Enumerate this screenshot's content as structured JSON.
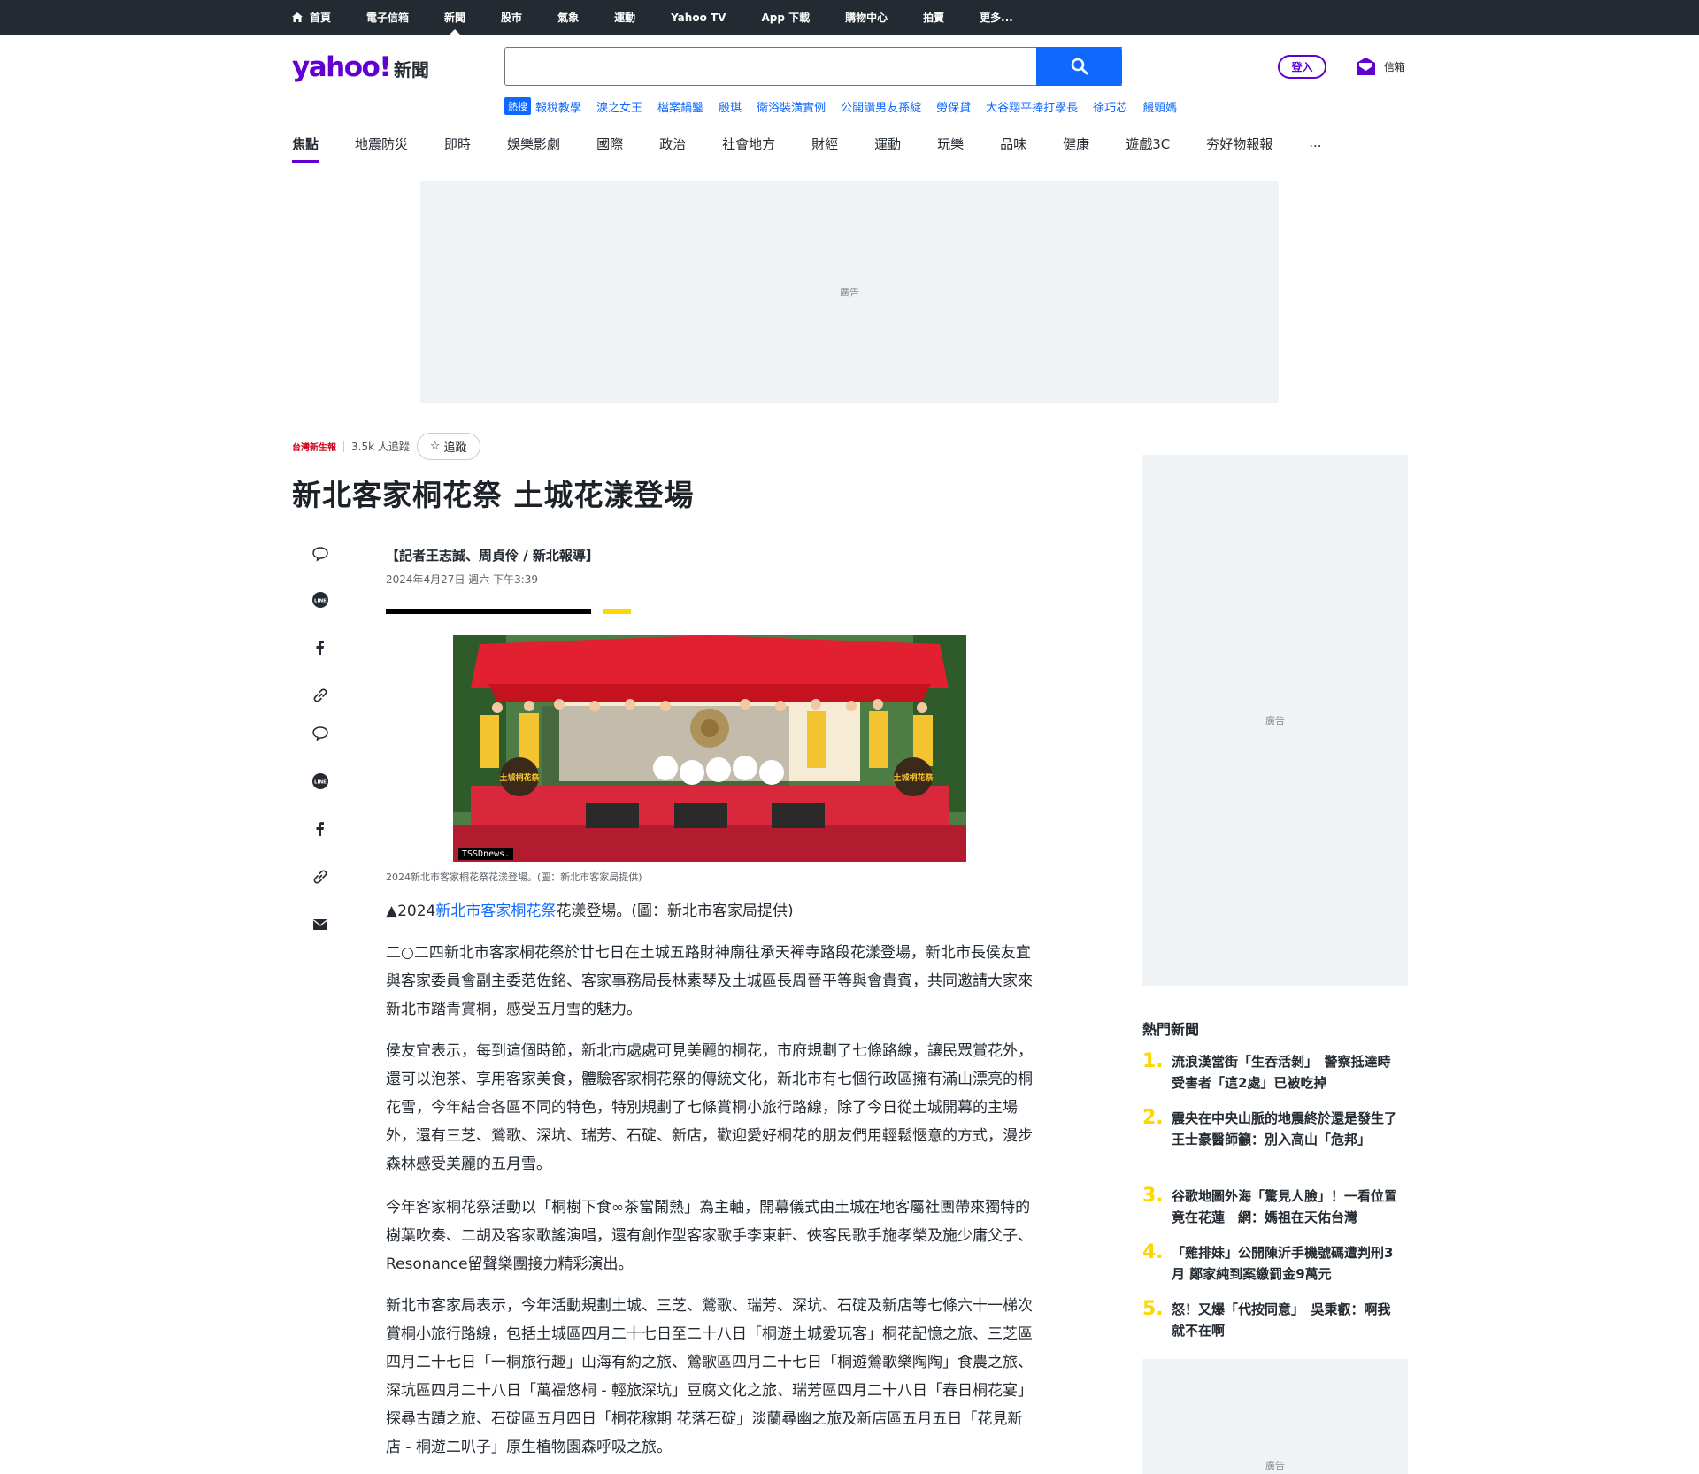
{
  "topnav": {
    "items": [
      "首頁",
      "電子信箱",
      "新聞",
      "股市",
      "氣象",
      "運動",
      "Yahoo TV",
      "App 下載",
      "購物中心",
      "拍賣",
      "更多..."
    ]
  },
  "header": {
    "logo": "yahoo!",
    "logo_sub": "新聞",
    "search_placeholder": "",
    "login": "登入",
    "mail": "信箱"
  },
  "trending": {
    "badge": "熱搜",
    "links": [
      "報稅教學",
      "淚之女王",
      "檔案鍋鑿",
      "殷琪",
      "衛浴裝潢實例",
      "公開讚男友孫綻",
      "勞保貸",
      "大谷翔平捧打學長",
      "徐巧芯",
      "饅頭媽"
    ]
  },
  "categories": [
    "焦點",
    "地震防災",
    "即時",
    "娛樂影劇",
    "國際",
    "政治",
    "社會地方",
    "財經",
    "運動",
    "玩樂",
    "品味",
    "健康",
    "遊戲3C",
    "夯好物報報",
    "..."
  ],
  "ads": {
    "label": "廣告"
  },
  "article": {
    "source_logo": "台灣新生報",
    "followers": "3.5k 人追蹤",
    "follow": "追蹤",
    "title": "新北客家桐花祭 土城花漾登場",
    "byline": "【記者王志誠、周貞伶 / 新北報導】",
    "date": "2024年4月27日 週六 下午3:39",
    "photo_tag": "TSSDnews.",
    "photo_sign_1": "土城桐花祭",
    "photo_sign_2": "土城桐花祭",
    "caption": "2024新北市客家桐花祭花漾登場。(圖：新北市客家局提供)",
    "lead_prefix": "▲2024",
    "lead_link": "新北市客家桐花祭",
    "lead_suffix": "花漾登場。(圖：新北市客家局提供)",
    "paragraphs": [
      "二○二四新北市客家桐花祭於廿七日在土城五路財神廟往承天禪寺路段花漾登場，新北市長侯友宜與客家委員會副主委范佐銘、客家事務局長林素琴及土城區長周晉平等與會貴賓，共同邀請大家來新北市踏青賞桐，感受五月雪的魅力。",
      "侯友宜表示，每到這個時節，新北市處處可見美麗的桐花，市府規劃了七條路線，讓民眾賞花外，還可以泡茶、享用客家美食，體驗客家桐花祭的傳統文化，新北市有七個行政區擁有滿山漂亮的桐花雪，今年結合各區不同的特色，特別規劃了七條賞桐小旅行路線，除了今日從土城開幕的主場外，還有三芝、鶯歌、深坑、瑞芳、石碇、新店，歡迎愛好桐花的朋友們用輕鬆愜意的方式，漫步森林感受美麗的五月雪。",
      "今年客家桐花祭活動以「桐樹下食∞茶當鬧熱」為主軸，開幕儀式由土城在地客屬社團帶來獨特的樹葉吹奏、二胡及客家歌謠演唱，還有創作型客家歌手李東軒、俠客民歌手施孝榮及施少庸父子、Resonance留聲樂團接力精彩演出。",
      "新北市客家局表示，今年活動規劃土城、三芝、鶯歌、瑞芳、深坑、石碇及新店等七條六十一梯次賞桐小旅行路線，包括土城區四月二十七日至二十八日「桐遊土城愛玩客」桐花記憶之旅、三芝區四月二十七日「一桐旅行趣」山海有約之旅、鶯歌區四月二十七日「桐遊鶯歌樂陶陶」食農之旅、深坑區四月二十八日「萬福悠桐 - 輕旅深坑」豆腐文化之旅、瑞芳區四月二十八日「春日桐花宴」探尋古蹟之旅、石碇區五月四日「桐花稼期 花落石碇」淡蘭尋幽之旅及新店區五月五日「花見新店 - 桐遊二叭子」原生植物園森呼吸之旅。"
    ]
  },
  "sidebar": {
    "hot_title": "熱門新聞",
    "hot_items": [
      {
        "num": "1.",
        "text": "流浪漢當街「生吞活剝」　警察抵達時受害者「這2處」已被吃掉"
      },
      {
        "num": "2.",
        "text": "震央在中央山脈的地震終於還是發生了　王士豪醫師籲：別入高山「危邦」"
      },
      {
        "num": "3.",
        "text": "谷歌地圖外海「驚見人臉」！一看位置竟在花蓮　網：媽祖在天佑台灣"
      },
      {
        "num": "4.",
        "text": "「雞排妹」公開陳沂手機號碼遭判刑3月 鄭家純到案繳罰金9萬元"
      },
      {
        "num": "5.",
        "text": "怒！又爆「代按同意」　吳秉叡：啊我就不在啊"
      }
    ]
  },
  "colors": {
    "brand": "#6001d2",
    "link": "#0f69ff",
    "topbar": "#232a31",
    "accent_yellow": "#fed700"
  }
}
